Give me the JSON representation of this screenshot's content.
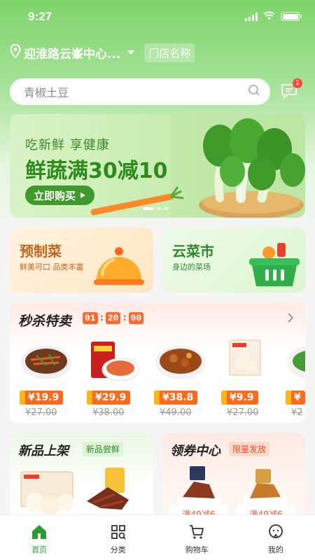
{
  "status_bar": {
    "time": "9:27"
  },
  "header": {
    "location": "迎淮路云峯中心...",
    "store_name": "门店名称"
  },
  "search": {
    "placeholder": "青椒土豆",
    "message_badge": "1"
  },
  "banner": {
    "subtitle": "吃新鲜 享健康",
    "title": "鲜蔬满30减10",
    "button": "立即购买",
    "slide_count": 3,
    "active_slide": 1
  },
  "categories": [
    {
      "title": "预制菜",
      "desc": "鲜美可口 品类丰富"
    },
    {
      "title": "云菜市",
      "desc": "身边的菜场"
    }
  ],
  "flash_sale": {
    "title": "秒杀特卖",
    "timer": [
      "01",
      "20",
      "00"
    ],
    "products": [
      {
        "price": "¥19.9",
        "original": "¥27.00"
      },
      {
        "price": "¥29.9",
        "original": "¥38.00"
      },
      {
        "price": "¥38.8",
        "original": "¥49.00"
      },
      {
        "price": "¥9.9",
        "original": "¥27.00"
      },
      {
        "price": "¥",
        "original": "¥2"
      }
    ]
  },
  "new_arrivals": {
    "title": "新品上架",
    "tag": "新品尝鲜"
  },
  "coupons": {
    "title": "领券中心",
    "tag": "限量发放",
    "coupon_text": [
      "满49减6",
      "满49减6"
    ]
  },
  "tabbar": [
    {
      "label": "首页"
    },
    {
      "label": "分类"
    },
    {
      "label": "购物车"
    },
    {
      "label": "我的"
    }
  ],
  "colors": {
    "primary_green": "#2f9a33",
    "accent_orange": "#ff6a1e"
  }
}
